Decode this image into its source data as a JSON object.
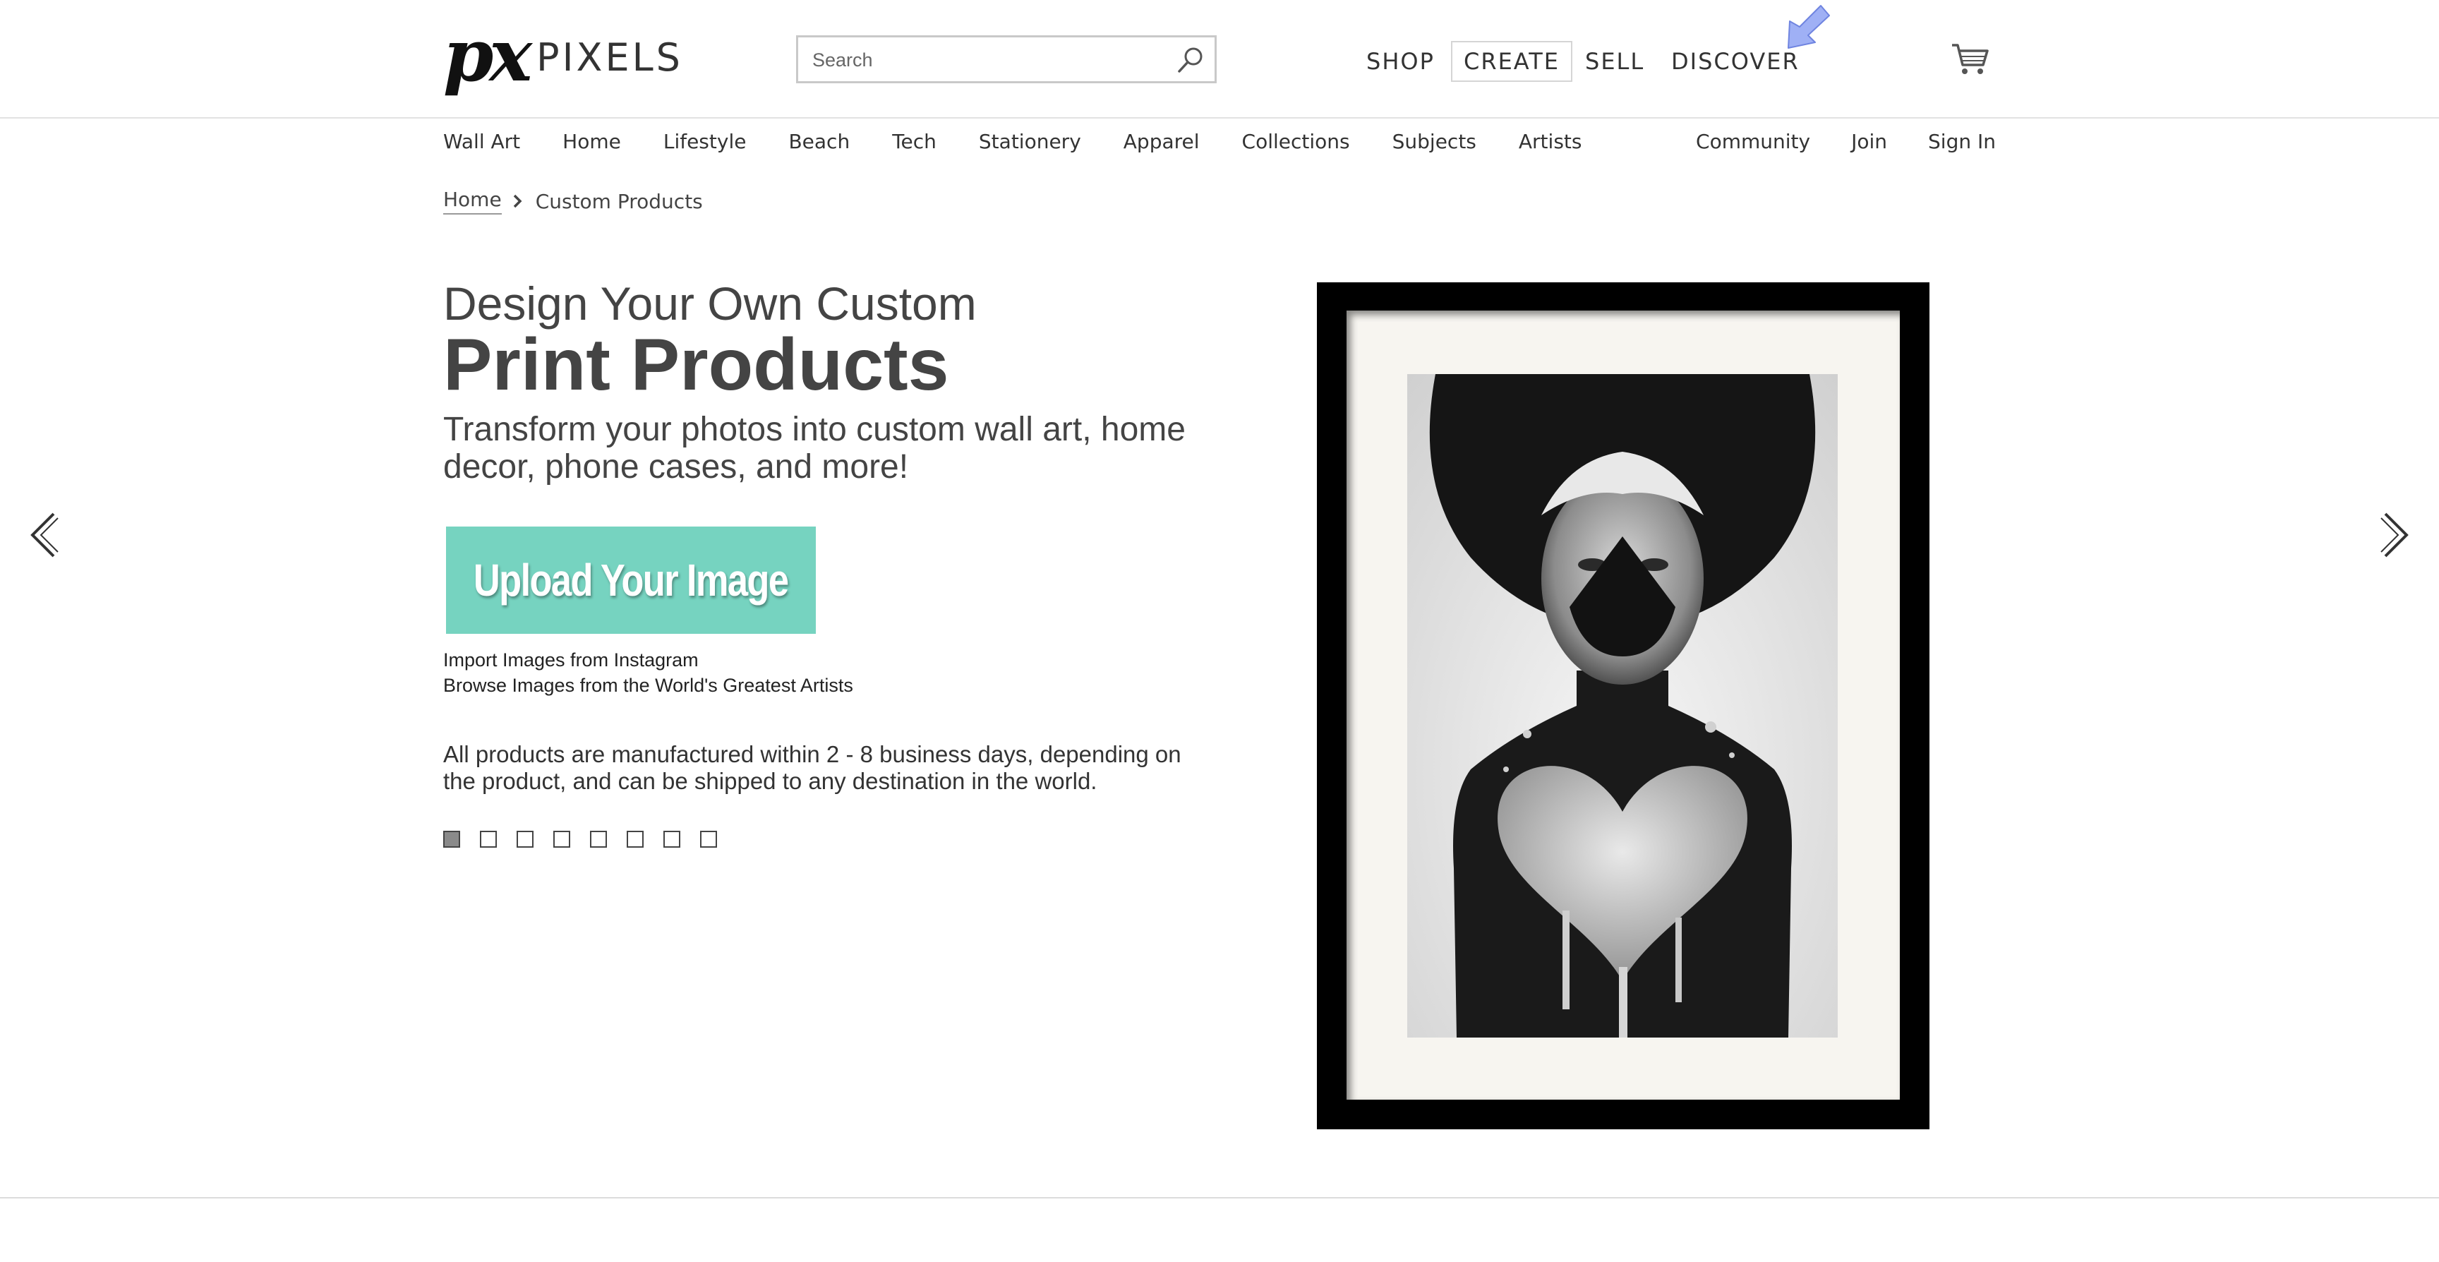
{
  "header": {
    "logo_mark": "px",
    "logo_text": "PIXELS",
    "search_placeholder": "Search",
    "nav": [
      {
        "label": "SHOP"
      },
      {
        "label": "CREATE",
        "active": true
      },
      {
        "label": "SELL"
      },
      {
        "label": "DISCOVER"
      }
    ]
  },
  "subnav": {
    "left": [
      "Wall Art",
      "Home",
      "Lifestyle",
      "Beach",
      "Tech",
      "Stationery",
      "Apparel",
      "Collections",
      "Subjects",
      "Artists"
    ],
    "right": [
      "Community",
      "Join",
      "Sign In"
    ]
  },
  "breadcrumb": {
    "home": "Home",
    "current": "Custom Products"
  },
  "hero": {
    "line1": "Design Your Own Custom",
    "line2": "Print Products",
    "subtitle": "Transform your photos into custom wall art, home decor, phone cases, and more!",
    "upload_button": "Upload Your Image",
    "link_instagram": "Import Images from Instagram",
    "link_artists": "Browse Images from the World's Greatest Artists",
    "info": "All products are manufactured within 2 - 8 business days, depending on the product, and can be shipped to any destination in the world."
  },
  "slider": {
    "slide_count": 8,
    "active_index": 0
  },
  "colors": {
    "accent_button": "#76d3c0",
    "text": "#444444",
    "cursor": "#8ea2f0"
  },
  "icons": [
    "search-icon",
    "cart-icon",
    "chevron-left-icon",
    "chevron-right-icon",
    "cursor-arrow-icon"
  ]
}
